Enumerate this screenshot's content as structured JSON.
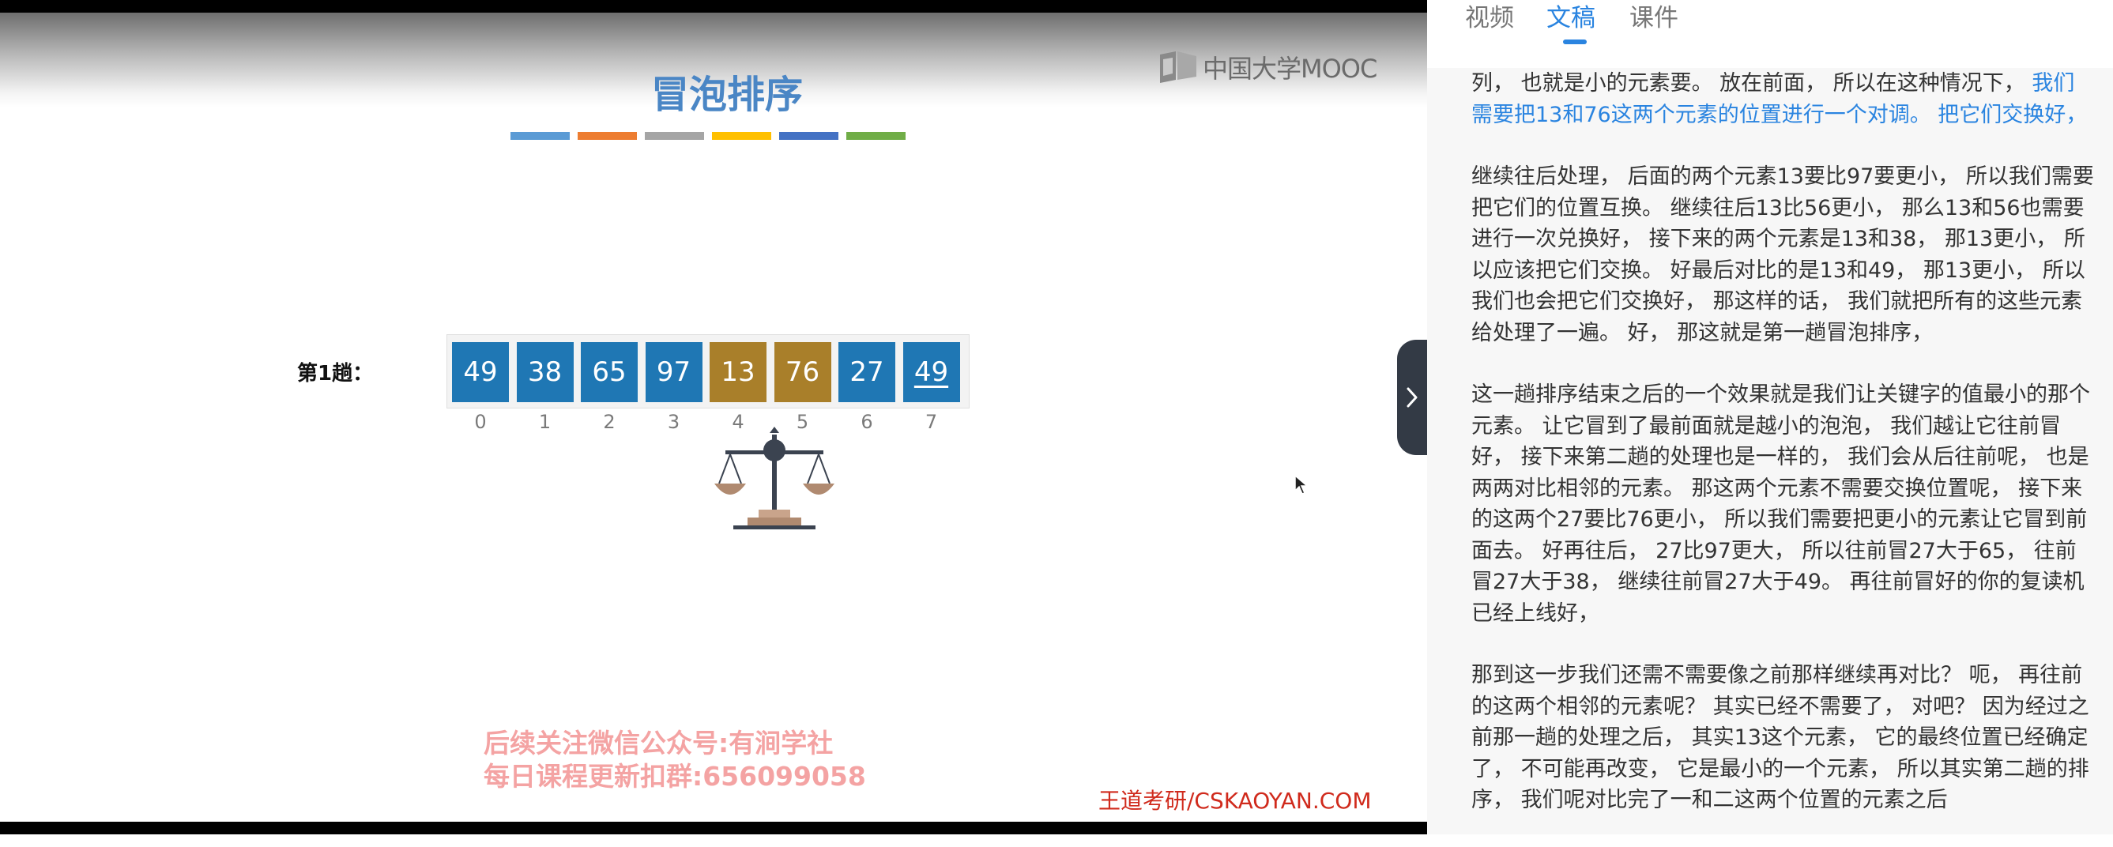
{
  "video": {
    "slide_title": "冒泡排序",
    "logo_text": "中国大学MOOC",
    "strip_colors": [
      "#5b9bd5",
      "#ed7d31",
      "#a5a5a5",
      "#ffc000",
      "#4472c4",
      "#70ad47"
    ],
    "pass_label": "第1趟：",
    "array": [
      {
        "value": "49",
        "index": "0",
        "color": "#1f77b4"
      },
      {
        "value": "38",
        "index": "1",
        "color": "#1f77b4"
      },
      {
        "value": "65",
        "index": "2",
        "color": "#1f77b4"
      },
      {
        "value": "97",
        "index": "3",
        "color": "#1f77b4"
      },
      {
        "value": "13",
        "index": "4",
        "color": "#a97f2a"
      },
      {
        "value": "76",
        "index": "5",
        "color": "#a97f2a"
      },
      {
        "value": "27",
        "index": "6",
        "color": "#1f77b4"
      },
      {
        "value": "49",
        "index": "7",
        "color": "#1f77b4",
        "underline": true
      }
    ],
    "promo_line1": "后续关注微信公众号:有涧学社",
    "promo_line2": "每日课程更新扣群:656099058",
    "brand_text": "王道考研/CSKAOYAN.COM"
  },
  "panel": {
    "tabs": [
      {
        "label": "视频",
        "active": false
      },
      {
        "label": "文稿",
        "active": true
      },
      {
        "label": "课件",
        "active": false
      }
    ],
    "collapse_icon": "chevron-right-icon",
    "transcript": {
      "p1_normal": "列， 也就是小的元素要。 放在前面， 所以在这种情况下， ",
      "p1_highlight": "我们需要把13和76这两个元素的位置进行一个对调。 把它们交换好，",
      "p2": "继续往后处理， 后面的两个元素13要比97要更小， 所以我们需要把它们的位置互换。 继续往后13比56更小， 那么13和56也需要进行一次兑换好， 接下来的两个元素是13和38， 那13更小， 所以应该把它们交换。 好最后对比的是13和49， 那13更小， 所以我们也会把它们交换好， 那这样的话， 我们就把所有的这些元素给处理了一遍。 好， 那这就是第一趟冒泡排序，",
      "p3": "这一趟排序结束之后的一个效果就是我们让关键字的值最小的那个元素。 让它冒到了最前面就是越小的泡泡， 我们越让它往前冒好， 接下来第二趟的处理也是一样的， 我们会从后往前呢， 也是两两对比相邻的元素。 那这两个元素不需要交换位置呢， 接下来的这两个27要比76更小， 所以我们需要把更小的元素让它冒到前面去。 好再往后， 27比97更大， 所以往前冒27大于65， 往前冒27大于38， 继续往前冒27大于49。 再往前冒好的你的复读机已经上线好，",
      "p4": "那到这一步我们还需不需要像之前那样继续再对比？ 呃， 再往前的这两个相邻的元素呢？ 其实已经不需要了， 对吧？ 因为经过之前那一趟的处理之后， 其实13这个元素， 它的最终位置已经确定了， 不可能再改变， 它是最小的一个元素， 所以其实第二趟的排序， 我们呢对比完了一和二这两个位置的元素之后"
    }
  }
}
